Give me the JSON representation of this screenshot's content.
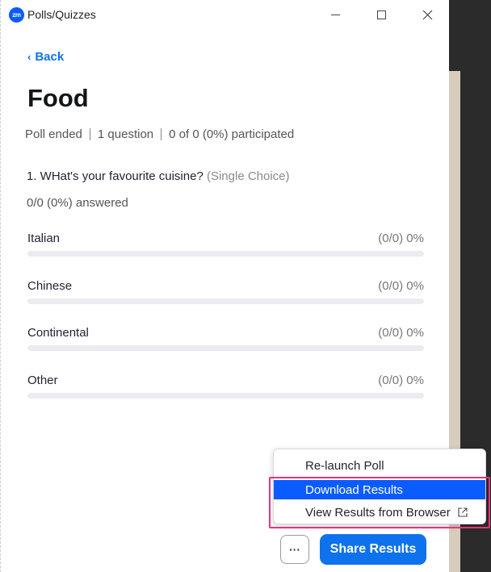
{
  "window": {
    "logo_text": "zm",
    "title": "Polls/Quizzes"
  },
  "nav": {
    "back_label": "Back"
  },
  "poll": {
    "title": "Food",
    "status": "Poll ended",
    "question_count": "1 question",
    "participation": "0 of 0 (0%) participated"
  },
  "question": {
    "text": "1. WHat's your favourite cuisine?",
    "type": "(Single Choice)",
    "answered": "0/0 (0%) answered",
    "options": [
      {
        "label": "Italian",
        "result": "(0/0) 0%",
        "percent": 0
      },
      {
        "label": "Chinese",
        "result": "(0/0) 0%",
        "percent": 0
      },
      {
        "label": "Continental",
        "result": "(0/0) 0%",
        "percent": 0
      },
      {
        "label": "Other",
        "result": "(0/0) 0%",
        "percent": 0
      }
    ]
  },
  "menu": {
    "items": [
      {
        "label": "Re-launch Poll"
      },
      {
        "label": "Download Results"
      },
      {
        "label": "View Results from Browser",
        "icon": "external-link-icon"
      }
    ]
  },
  "footer": {
    "more_label": "···",
    "share_label": "Share Results"
  },
  "colors": {
    "accent": "#0e72ed",
    "menu_highlight": "#0b5cff",
    "annotation_box": "#e8337c"
  }
}
